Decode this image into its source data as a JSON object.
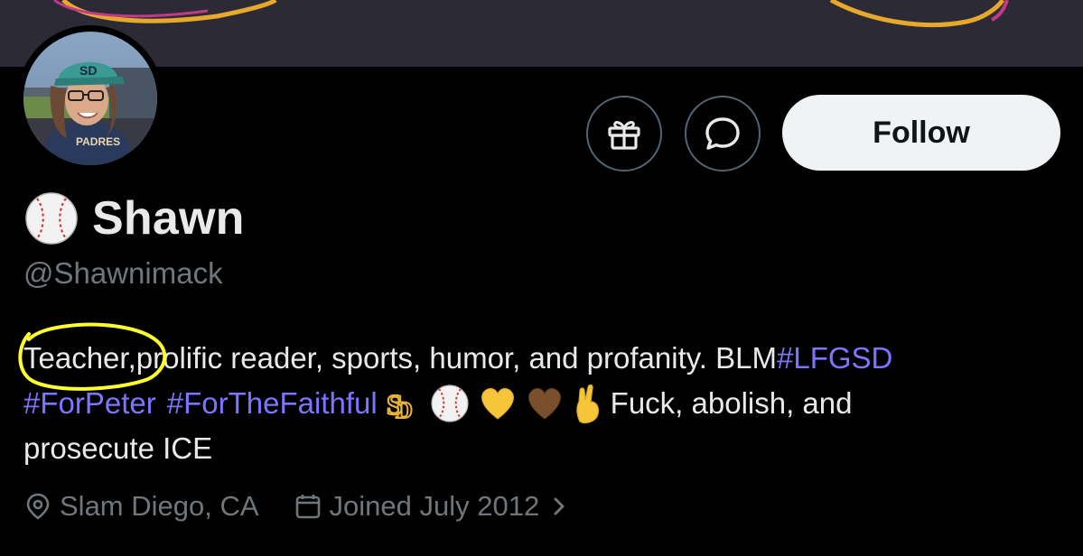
{
  "profile": {
    "display_name": "Shawn",
    "handle": "@Shawnimack",
    "name_emoji": "baseball-icon"
  },
  "actions": {
    "gift_icon": "gift-icon",
    "message_icon": "message-bubble-icon",
    "follow_label": "Follow"
  },
  "bio": {
    "teacher_word": "Teacher,",
    "line1_text": "prolific reader, sports, humor, and profanity. BLM ",
    "hashtag1": "#LFGSD",
    "hashtag2": "#ForPeter",
    "hashtag3": "#ForTheFaithful",
    "line2_tail": "Fuck, abolish, and",
    "line3_text": "prosecute ICE",
    "emojis": [
      "padres-sd-logo-icon",
      "baseball-icon",
      "yellow-heart-icon",
      "brown-heart-icon",
      "crossed-fingers-icon"
    ],
    "annotation": "yellow-highlight-circle"
  },
  "meta": {
    "location": "Slam Diego, CA",
    "joined": "Joined July 2012",
    "location_icon": "location-pin-icon",
    "calendar_icon": "calendar-icon",
    "chevron_icon": "chevron-right-icon"
  },
  "colors": {
    "background": "#000000",
    "text_primary": "#e7e9ea",
    "text_secondary": "#71767b",
    "link": "#7d75ff",
    "follow_bg": "#eff3f4",
    "annotation": "#ffff2e",
    "banner": "#2c2b35"
  }
}
